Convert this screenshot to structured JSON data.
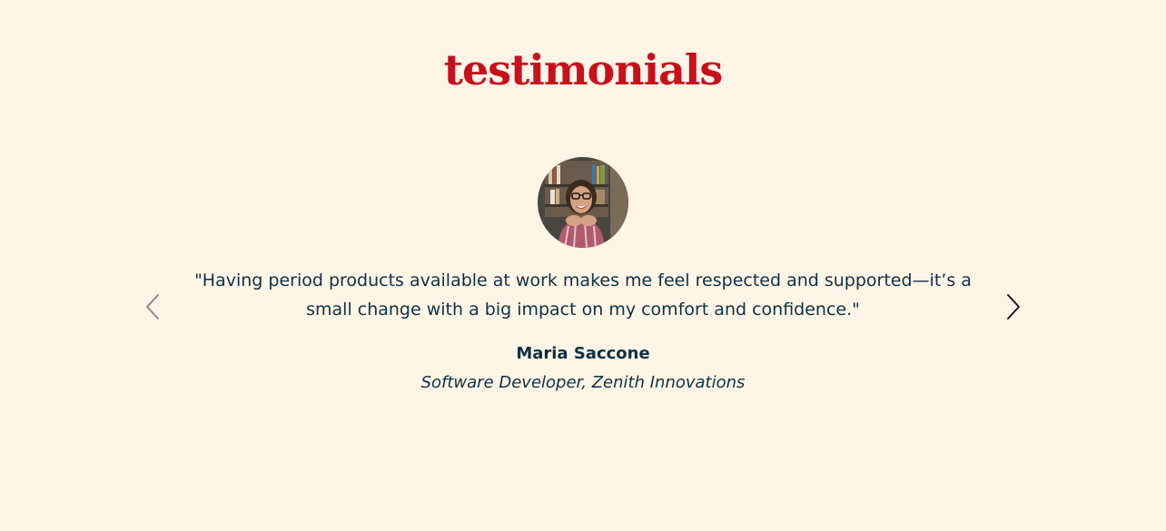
{
  "section": {
    "heading": "testimonials"
  },
  "testimonial": {
    "quote": "\"Having period products available at work makes me feel respected and supported—it’s a small change with a big impact on my comfort and confidence.\"",
    "name": "Maria Saccone",
    "role": "Software Developer, Zenith Innovations",
    "avatar_icon": "person-photo"
  },
  "controls": {
    "prev_icon": "chevron-left-icon",
    "next_icon": "chevron-right-icon"
  },
  "colors": {
    "background": "#fef5e7",
    "heading": "#c8101c",
    "text": "#0f3142"
  }
}
